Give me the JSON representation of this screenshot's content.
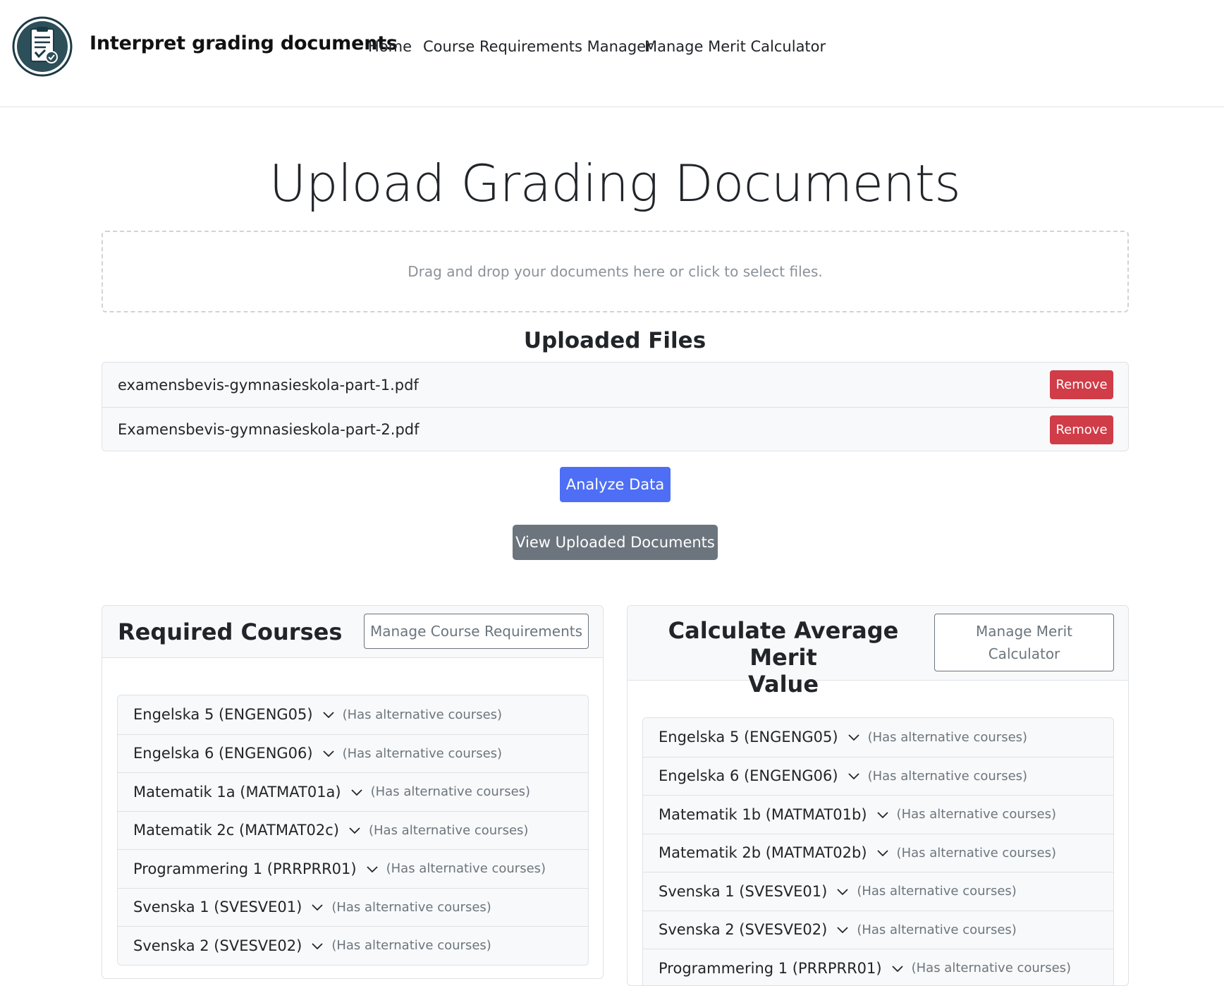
{
  "navbar": {
    "brand": "Interpret grading documents",
    "links": [
      "Home",
      "Course Requirements Manager",
      "Manage Merit Calculator"
    ]
  },
  "main": {
    "title": "Upload Grading Documents",
    "dropzone_text": "Drag and drop your documents here or click to select files.",
    "uploaded_heading": "Uploaded Files",
    "files": [
      {
        "name": "examensbevis-gymnasieskola-part-1.pdf",
        "action": "Remove"
      },
      {
        "name": "Examensbevis-gymnasieskola-part-2.pdf",
        "action": "Remove"
      }
    ],
    "analyze_label": "Analyze Data",
    "view_label": "View Uploaded Documents"
  },
  "required_courses": {
    "title": "Required Courses",
    "manage_label": "Manage Course Requirements",
    "courses": [
      {
        "name": "Engelska 5 (ENGENG05)",
        "note": "(Has alternative courses)"
      },
      {
        "name": "Engelska 6 (ENGENG06)",
        "note": "(Has alternative courses)"
      },
      {
        "name": "Matematik 1a (MATMAT01a)",
        "note": "(Has alternative courses)"
      },
      {
        "name": "Matematik 2c (MATMAT02c)",
        "note": "(Has alternative courses)"
      },
      {
        "name": "Programmering 1 (PRRPRR01)",
        "note": "(Has alternative courses)"
      },
      {
        "name": "Svenska 1 (SVESVE01)",
        "note": "(Has alternative courses)"
      },
      {
        "name": "Svenska 2 (SVESVE02)",
        "note": "(Has alternative courses)"
      }
    ]
  },
  "merit": {
    "title_line1": "Calculate Average Merit",
    "title_line2": "Value",
    "manage_line1": "Manage Merit",
    "manage_line2": "Calculator",
    "courses": [
      {
        "name": "Engelska 5 (ENGENG05)",
        "note": "(Has alternative courses)"
      },
      {
        "name": "Engelska 6 (ENGENG06)",
        "note": "(Has alternative courses)"
      },
      {
        "name": "Matematik 1b (MATMAT01b)",
        "note": "(Has alternative courses)"
      },
      {
        "name": "Matematik 2b (MATMAT02b)",
        "note": "(Has alternative courses)"
      },
      {
        "name": "Svenska 1 (SVESVE01)",
        "note": "(Has alternative courses)"
      },
      {
        "name": "Svenska 2 (SVESVE02)",
        "note": "(Has alternative courses)"
      },
      {
        "name": "Programmering 1 (PRRPRR01)",
        "note": "(Has alternative courses)"
      }
    ]
  },
  "colors": {
    "primary": "#4d6ef5",
    "danger": "#d03c48",
    "secondary": "#6c757d"
  }
}
